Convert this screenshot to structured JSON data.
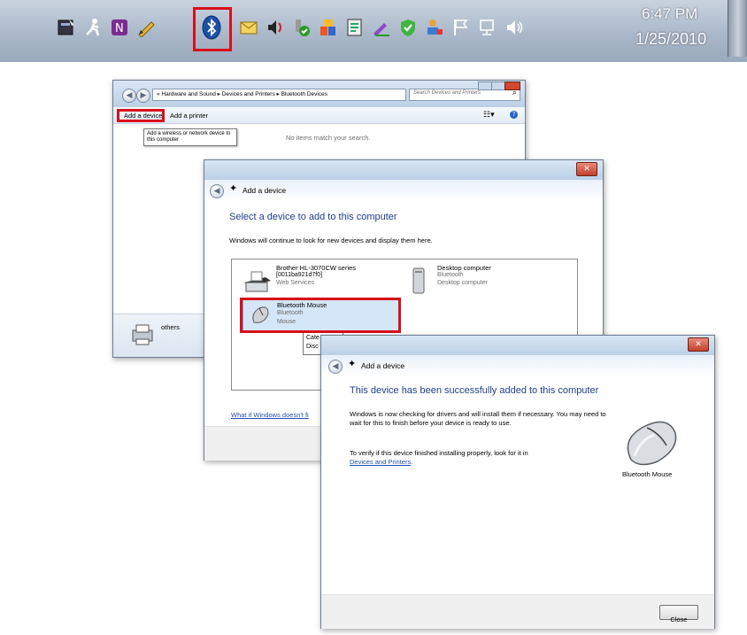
{
  "taskbar": {
    "icons": [
      "task-manager-icon",
      "run-person-icon",
      "onenote-icon",
      "pen-icon",
      "bluetooth-icon",
      "mail-icon",
      "volume-speaker-icon",
      "check-program-icon",
      "colored-blocks-icon",
      "notes-icon",
      "pencil-check-icon",
      "green-check-icon",
      "network-user-icon",
      "flag-icon",
      "network-icon",
      "speaker-icon"
    ],
    "clock_time": "6:47 PM",
    "clock_date": "1/25/2010"
  },
  "explorer": {
    "breadcrumb": "« Hardware and Sound ▸ Devices and Printers ▸ Bluetooth Devices",
    "search_placeholder": "Search Devices and Printers",
    "toolbar_add_device": "Add a device",
    "toolbar_add_printer": "Add a printer",
    "tooltip": "Add a wireless or network device to this computer",
    "empty_message": "No items match your search.",
    "bottom_label": "others"
  },
  "wizard1": {
    "title": "Add a device",
    "heading": "Select a device to add to this computer",
    "subtext": "Windows will continue to look for new devices and display them here.",
    "devices": [
      {
        "name": "Brother HL-3070CW series",
        "line2": "[0011ba921d7f0]",
        "line3": "Web Services"
      },
      {
        "name": "Desktop computer",
        "line2": "Bluetooth",
        "line3": "Desktop computer"
      },
      {
        "name": "Bluetooth Mouse",
        "line2": "Bluetooth",
        "line3": "Mouse"
      }
    ],
    "tooltip_partial1": "Cate",
    "tooltip_partial2": "Disc",
    "help_link": "What if Windows doesn't fi"
  },
  "wizard2": {
    "title": "Add a device",
    "heading": "This device has been successfully added to this computer",
    "para1": "Windows is now checking for drivers and will install them if necessary. You may need to wait for this to finish before your device is ready to use.",
    "para2_prefix": "To verify if this device finished installing properly, look for it in",
    "para2_link": "Devices and Printers",
    "para2_suffix": ".",
    "device_label": "Bluetooth Mouse",
    "close_button": "Close"
  }
}
